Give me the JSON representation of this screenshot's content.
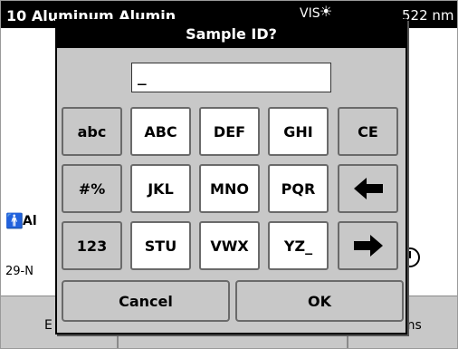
{
  "app": {
    "title": "10 Aluminum Alumin",
    "vis_label": "VIS",
    "wavelength": "522 nm",
    "operator_label": "Al",
    "date_label": "29-N",
    "bottom_left_label": "E",
    "bottom_right_label": "ons"
  },
  "dialog": {
    "title": "Sample ID?",
    "input_value": "_",
    "keys": {
      "abc": "abc",
      "ABC": "ABC",
      "DEF": "DEF",
      "GHI": "GHI",
      "CE": "CE",
      "symbols": "#%",
      "JKL": "JKL",
      "MNO": "MNO",
      "PQR": "PQR",
      "num": "123",
      "STU": "STU",
      "VWX": "VWX",
      "YZ": "YZ_"
    },
    "icons": {
      "backspace": "arrow-left-icon",
      "forward": "arrow-right-icon"
    },
    "cancel_label": "Cancel",
    "ok_label": "OK"
  }
}
